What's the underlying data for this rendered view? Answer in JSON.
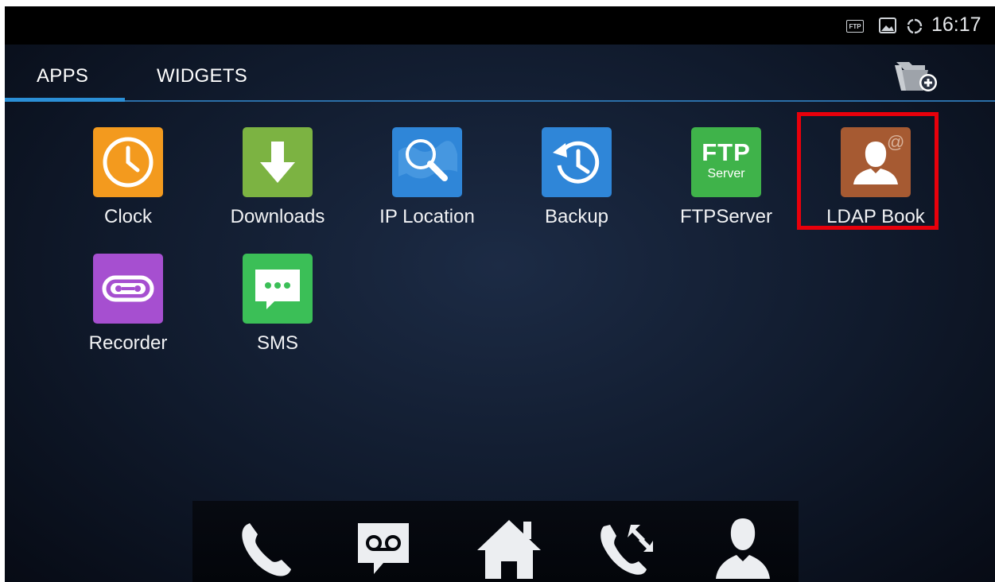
{
  "status_bar": {
    "ftp_badge": "FTP",
    "time": "16:17"
  },
  "tabs": {
    "apps_label": "APPS",
    "widgets_label": "WIDGETS"
  },
  "apps": [
    {
      "label": "Clock",
      "icon": "clock-icon",
      "color": "#f39a1e"
    },
    {
      "label": "Downloads",
      "icon": "download-arrow-icon",
      "color": "#7cb342"
    },
    {
      "label": "IP Location",
      "icon": "magnifier-world-icon",
      "color": "#2f86d8"
    },
    {
      "label": "Backup",
      "icon": "history-clock-icon",
      "color": "#2f86d8"
    },
    {
      "label": "FTPServer",
      "icon": "ftp-server-icon",
      "color": "#3fb34a",
      "icon_text": "FTP",
      "icon_subtext": "Server"
    },
    {
      "label": "LDAP Book",
      "icon": "contact-at-icon",
      "color": "#a65a32",
      "icon_text": "@"
    },
    {
      "label": "Recorder",
      "icon": "cassette-icon",
      "color": "#a64fd0"
    },
    {
      "label": "SMS",
      "icon": "chat-bubble-icon",
      "color": "#3bbf57"
    }
  ],
  "highlight_color": "#e8000b",
  "dock": [
    "phone-icon",
    "voicemail-icon",
    "home-icon",
    "call-transfer-icon",
    "contacts-icon"
  ]
}
